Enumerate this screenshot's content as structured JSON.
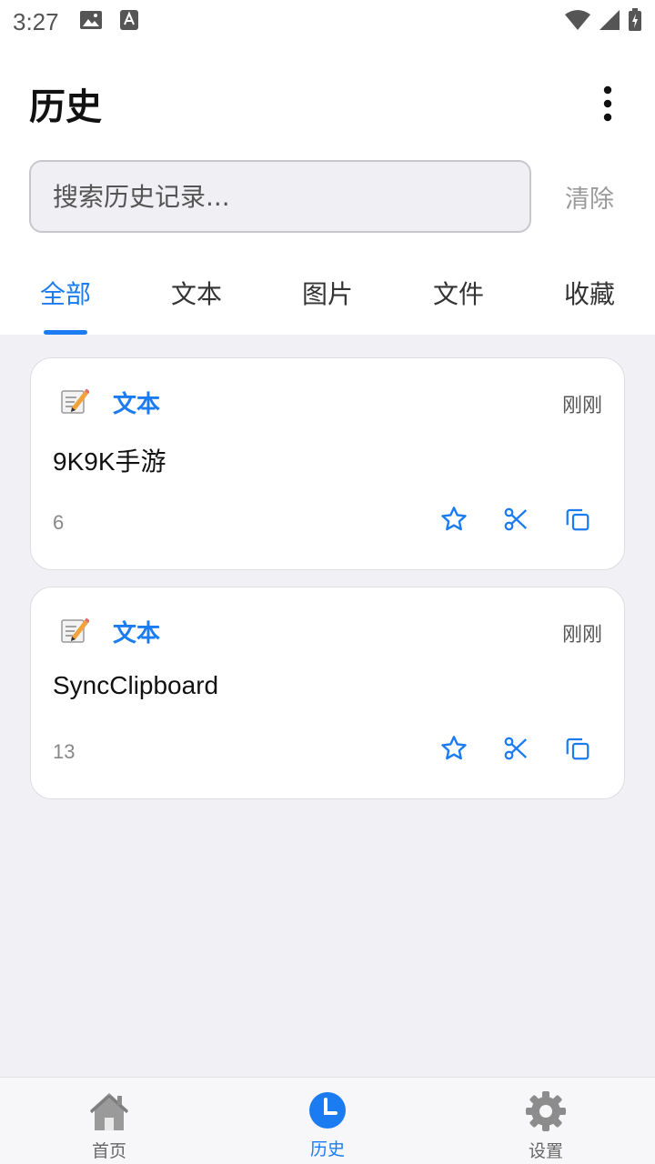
{
  "status_bar": {
    "time": "3:27"
  },
  "header": {
    "title": "历史"
  },
  "search": {
    "placeholder": "搜索历史记录...",
    "clear_label": "清除"
  },
  "tabs": [
    {
      "label": "全部",
      "active": true
    },
    {
      "label": "文本",
      "active": false
    },
    {
      "label": "图片",
      "active": false
    },
    {
      "label": "文件",
      "active": false
    },
    {
      "label": "收藏",
      "active": false
    }
  ],
  "items": [
    {
      "type_icon": "memo-icon",
      "type": "文本",
      "time": "刚刚",
      "content": "9K9K手游",
      "count": "6"
    },
    {
      "type_icon": "memo-icon",
      "type": "文本",
      "time": "刚刚",
      "content": "SyncClipboard",
      "count": "13"
    }
  ],
  "bottom_nav": [
    {
      "label": "首页",
      "icon": "home-icon",
      "active": false
    },
    {
      "label": "历史",
      "icon": "clock-icon",
      "active": true
    },
    {
      "label": "设置",
      "icon": "gear-icon",
      "active": false
    }
  ],
  "colors": {
    "accent": "#1a7cf0",
    "list_background": "#f1f1f5"
  }
}
